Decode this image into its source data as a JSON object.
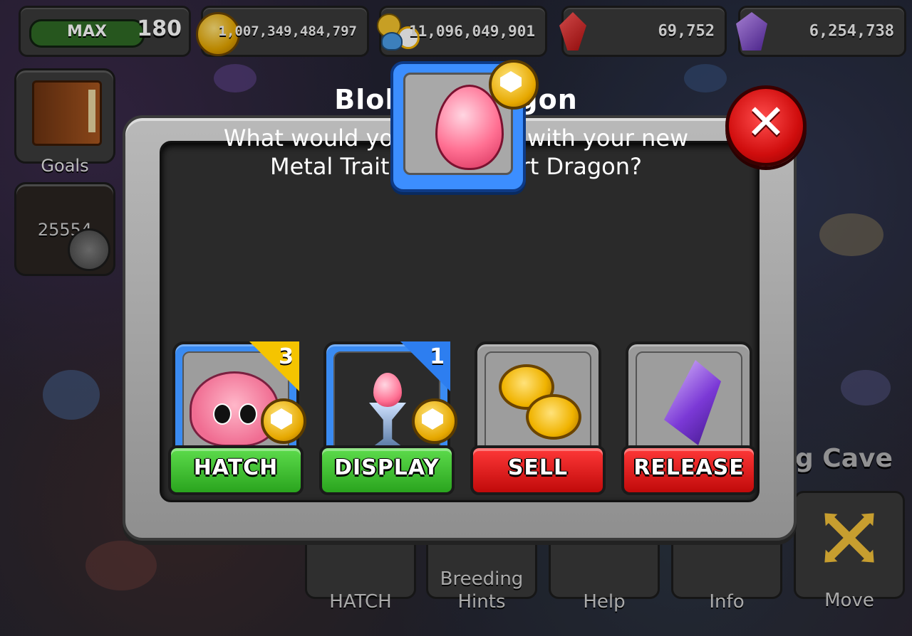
{
  "hud": {
    "xp_label": "MAX",
    "level": "180",
    "gold": "1,007,349,484,797",
    "food": "11,096,049,901",
    "gems": "69,752",
    "dark_essence": "6,254,738"
  },
  "side": {
    "goals_label": "Goals",
    "shield_count": "25554"
  },
  "toolbar": {
    "hatch_label": "HATCH",
    "breeding_hints_label_1": "Breeding",
    "breeding_hints_label_2": "Hints",
    "help_label": "Help",
    "info_label": "Info",
    "move_label": "Move",
    "cave_partial": "g Cave"
  },
  "dialog": {
    "title": "Blobert Dragon",
    "message_line1": "What would you like to do with your new",
    "message_line2": "Metal Trait Rare Blobert Dragon?",
    "close_symbol": "✕",
    "options": [
      {
        "label": "HATCH",
        "badge": "3"
      },
      {
        "label": "DISPLAY",
        "badge": "1"
      },
      {
        "label": "SELL"
      },
      {
        "label": "RELEASE"
      }
    ]
  },
  "colors": {
    "green_button": "#2aa41e",
    "red_button": "#c10a0a",
    "blue_frame": "#3a8bf2",
    "gold_badge": "#f5c400"
  }
}
